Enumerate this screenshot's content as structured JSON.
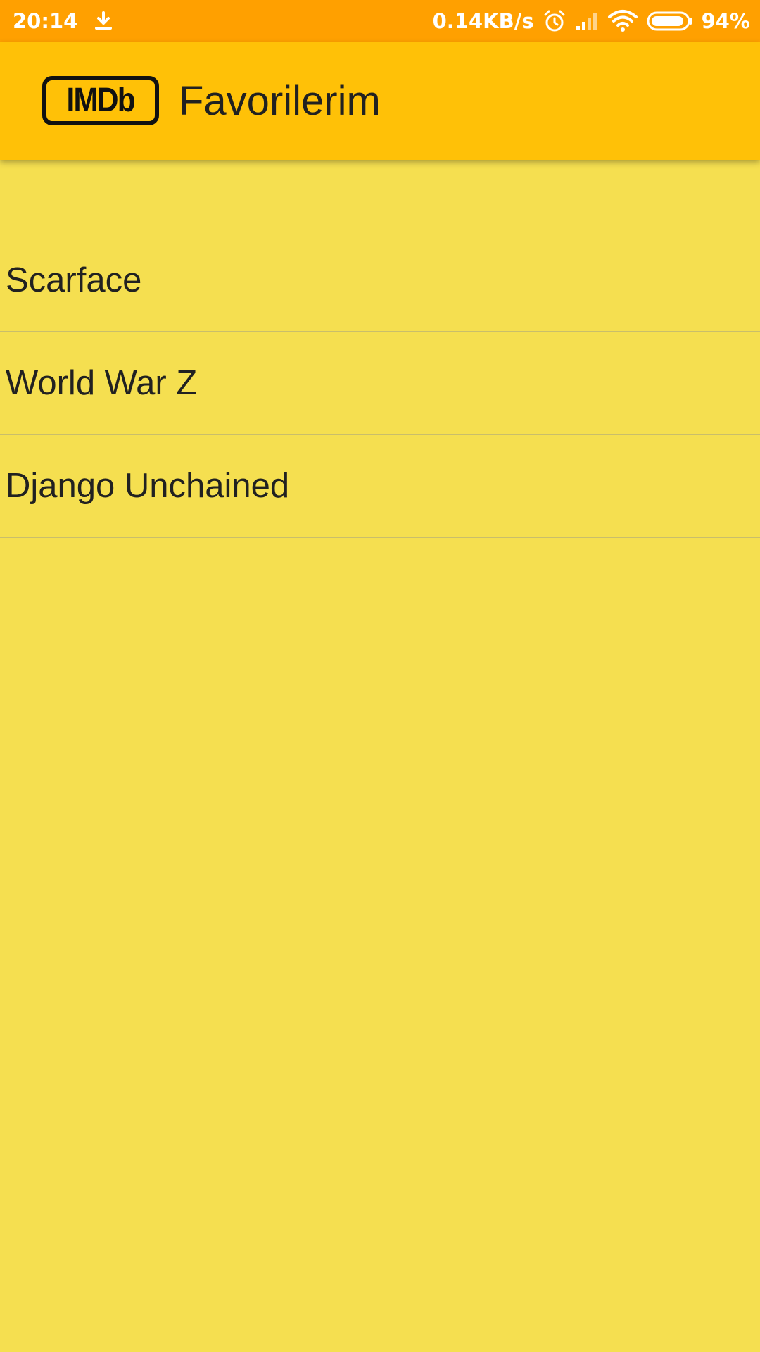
{
  "status_bar": {
    "time": "20:14",
    "network_speed": "0.14KB/s",
    "battery_percent": "94%",
    "battery_level": 0.94,
    "icons": [
      "download-icon",
      "alarm-icon",
      "signal-icon",
      "wifi-icon",
      "battery-icon"
    ]
  },
  "app_bar": {
    "logo_text": "IMDb",
    "title": "Favorilerim"
  },
  "favorites": [
    {
      "title": "Scarface"
    },
    {
      "title": "World War Z"
    },
    {
      "title": "Django Unchained"
    }
  ],
  "colors": {
    "status_bar": "#FFA000",
    "app_bar": "#FFC107",
    "background": "#F5DF50",
    "divider": "#C9BE6B",
    "text": "#212121"
  }
}
